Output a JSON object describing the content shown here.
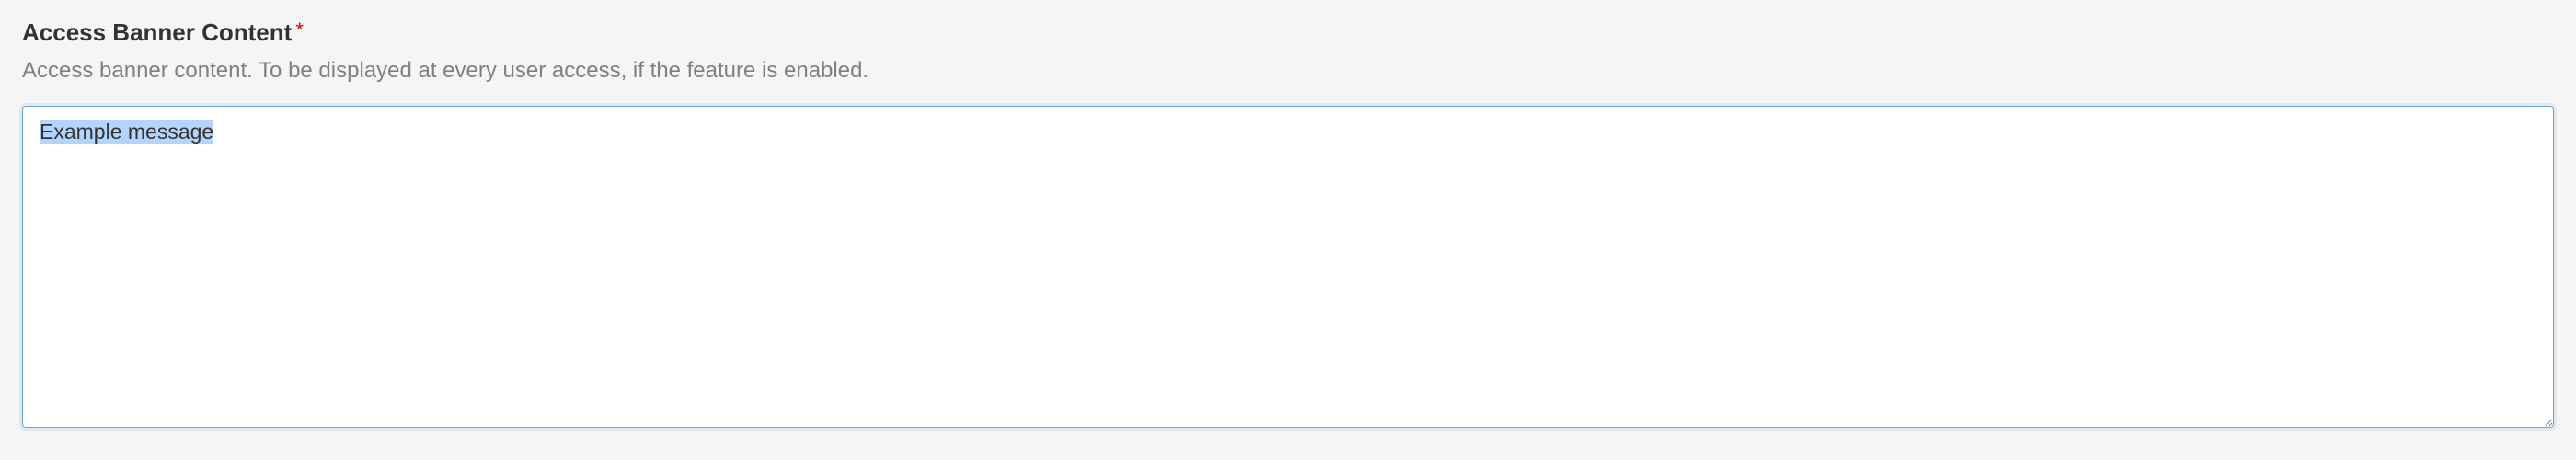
{
  "field": {
    "label": "Access Banner Content",
    "required_marker": "*",
    "description": "Access banner content. To be displayed at every user access, if the feature is enabled.",
    "value": "Example message"
  }
}
